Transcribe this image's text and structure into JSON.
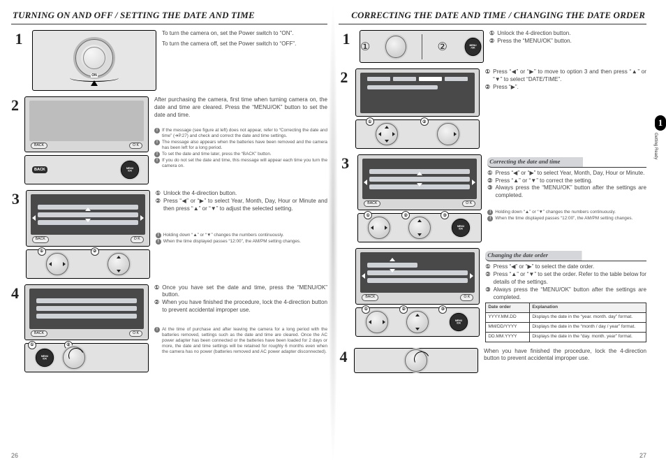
{
  "section_tab": {
    "number": "1",
    "label": "Getting Ready"
  },
  "left": {
    "title": "TURNING ON AND OFF / SETTING THE DATE AND TIME",
    "steps": {
      "1": {
        "num": "1",
        "dial": {
          "on_label": "ON"
        },
        "p1": "To turn the camera on, set the Power switch to “ON”.",
        "p2": "To turn the camera off, set the Power switch to “OFF”."
      },
      "2": {
        "num": "2",
        "lcd": {
          "back": "BACK",
          "ok": "MENU\n/OK"
        },
        "p1": "After purchasing the camera, first time when turning camera on, the date and time are cleared. Press the “MENU/OK” button to set the date and time.",
        "notes": [
          "If the message (see figure at left) does not appear, refer to “Correcting the date and time” (➜P.27) and check and correct the date and time settings.",
          "The message also appears when the batteries have been removed and the camera has been left for a long period.",
          "To set the date and time later, press the “BACK” button.",
          "If you do not set the date and time, this message will appear each time you turn the camera on."
        ]
      },
      "3": {
        "num": "3",
        "lcd": {
          "back": "BACK",
          "ok": "O K"
        },
        "li1_n": "①",
        "li1": "Unlock the 4-direction button.",
        "li2_n": "②",
        "li2": "Press “◀” or “▶” to select Year, Month, Day, Hour or Minute and then press “▲” or “▼” to adjust the selected setting.",
        "notes": [
          "Holding down “▲” or “▼” changes the numbers continuously.",
          "When the time displayed passes “12:00”, the AM/PM setting changes."
        ]
      },
      "4": {
        "num": "4",
        "lcd": {
          "back": "BACK",
          "ok": "O K"
        },
        "li1_n": "①",
        "li1": "Once you have set the date and time, press the “MENU/OK” button.",
        "li2_n": "②",
        "li2": "When you have finished the procedure, lock the 4-direction button to prevent accidental improper use.",
        "notes": [
          "At the time of purchase and after leaving the camera for a long period with the batteries removed, settings such as the date and time are cleared. Once the AC power adapter has been connected or the batteries have been loaded for 2 days or more, the date and time settings will be retained for roughly 6 months even when the camera has no power (batteries removed and AC power adapter disconnected)."
        ]
      }
    },
    "folio": "26"
  },
  "right": {
    "title": "CORRECTING THE DATE AND TIME / CHANGING THE DATE ORDER",
    "steps": {
      "1": {
        "num": "1",
        "li1_n": "①",
        "li1": "Unlock the 4-direction button.",
        "li2_n": "②",
        "li2": "Press the “MENU/OK” button."
      },
      "2": {
        "num": "2",
        "li1_n": "①",
        "li1": "Press “◀” or “▶” to move to option 3 and then press “▲” or “▼” to select “DATE/TIME”.",
        "li2_n": "②",
        "li2": "Press “▶”."
      },
      "3": {
        "num": "3",
        "sub": "Correcting the date and time",
        "li1_n": "①",
        "li1": "Press “◀” or “▶” to select Year, Month, Day, Hour or Minute.",
        "li2_n": "②",
        "li2": "Press “▲” or “▼” to correct the setting.",
        "li3_n": "③",
        "li3": "Always press the “MENU/OK” button after the settings are completed.",
        "notes": [
          "Holding down “▲” or “▼” changes the numbers continuously.",
          "When the time displayed passes “12:00”, the AM/PM setting changes."
        ]
      },
      "3b": {
        "sub": "Changing the date order",
        "li1_n": "①",
        "li1": "Press “◀” or “▶” to select the date order.",
        "li2_n": "②",
        "li2": "Press “▲” or “▼” to set the order. Refer to the table below for details of the settings.",
        "li3_n": "③",
        "li3": "Always press the “MENU/OK” button after the settings are completed.",
        "table": {
          "head": [
            "Date order",
            "Explanation"
          ],
          "rows": [
            [
              "YYYY.MM.DD",
              "Displays the date in the “year. month. day” format."
            ],
            [
              "MM/DD/YYYY",
              "Displays the date in the “month / day / year” format."
            ],
            [
              "DD.MM.YYYY",
              "Displays the date in the “day. month. year” format."
            ]
          ]
        }
      },
      "4": {
        "num": "4",
        "p": "When you have finished the procedure, lock the 4-direction button to prevent accidental improper use."
      }
    },
    "folio": "27"
  },
  "labels": {
    "menu_ok": "MENU\n/OK",
    "badges": [
      "①",
      "②",
      "③"
    ]
  }
}
